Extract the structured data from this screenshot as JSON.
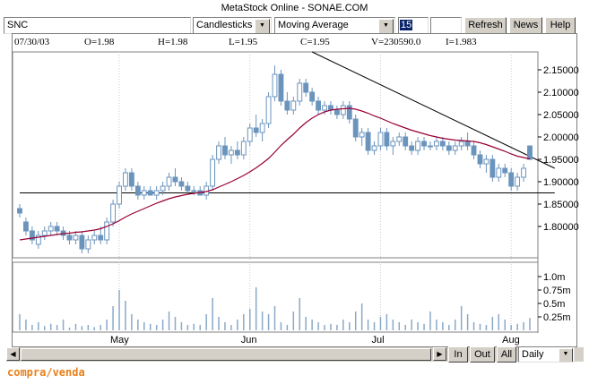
{
  "window": {
    "title": "MetaStock Online - SONAE.COM"
  },
  "toolbar": {
    "symbol_value": "SNC",
    "chart_type_value": "Candlesticks",
    "indicator_value": "Moving Average",
    "period_value": "15",
    "extra_value": "",
    "refresh_label": "Refresh",
    "news_label": "News",
    "help_label": "Help"
  },
  "quote": {
    "date": "07/30/03",
    "open": "O=1.98",
    "high": "H=1.98",
    "low": "L=1.95",
    "close": "C=1.95",
    "volume": "V=230590.0",
    "indicator": "I=1.983"
  },
  "price_axis": [
    "2.15000",
    "2.10000",
    "2.05000",
    "2.00000",
    "1.95000",
    "1.90000",
    "1.85000",
    "1.80000"
  ],
  "volume_axis": [
    "1.0m",
    "0.75m",
    "0.5m",
    "0.25m"
  ],
  "months": [
    "May",
    "Jun",
    "Jul",
    "Aug"
  ],
  "bottom_bar": {
    "in_label": "In",
    "out_label": "Out",
    "all_label": "All",
    "interval_value": "Daily"
  },
  "brand_text": "compra/venda",
  "colors": {
    "candle_up": "#ffffff",
    "candle_down": "#6b94bd",
    "candle_border": "#6b94bd",
    "moving_average": "#990033",
    "trend_lines": "#000000",
    "volume_bars": "#8aa8c8"
  },
  "chart_data": [
    {
      "type": "candlestick",
      "title": "",
      "ylim": [
        1.73,
        2.19
      ],
      "y_ticks": [
        2.15,
        2.1,
        2.05,
        2.0,
        1.95,
        1.9,
        1.85,
        1.8
      ],
      "x_ticks": [
        "May",
        "Jun",
        "Jul",
        "Aug"
      ],
      "ohlc": [
        [
          1.84,
          1.85,
          1.82,
          1.83
        ],
        [
          1.81,
          1.82,
          1.78,
          1.79
        ],
        [
          1.79,
          1.8,
          1.76,
          1.77
        ],
        [
          1.76,
          1.79,
          1.75,
          1.78
        ],
        [
          1.78,
          1.8,
          1.77,
          1.79
        ],
        [
          1.79,
          1.81,
          1.78,
          1.8
        ],
        [
          1.8,
          1.81,
          1.78,
          1.79
        ],
        [
          1.79,
          1.8,
          1.77,
          1.78
        ],
        [
          1.78,
          1.79,
          1.76,
          1.77
        ],
        [
          1.77,
          1.79,
          1.76,
          1.78
        ],
        [
          1.78,
          1.79,
          1.74,
          1.75
        ],
        [
          1.75,
          1.78,
          1.74,
          1.77
        ],
        [
          1.77,
          1.79,
          1.76,
          1.78
        ],
        [
          1.78,
          1.8,
          1.76,
          1.77
        ],
        [
          1.77,
          1.82,
          1.76,
          1.81
        ],
        [
          1.81,
          1.86,
          1.8,
          1.85
        ],
        [
          1.85,
          1.9,
          1.84,
          1.89
        ],
        [
          1.89,
          1.93,
          1.88,
          1.92
        ],
        [
          1.92,
          1.93,
          1.88,
          1.89
        ],
        [
          1.89,
          1.9,
          1.86,
          1.87
        ],
        [
          1.87,
          1.89,
          1.86,
          1.88
        ],
        [
          1.88,
          1.89,
          1.87,
          1.87
        ],
        [
          1.87,
          1.89,
          1.86,
          1.88
        ],
        [
          1.88,
          1.9,
          1.87,
          1.89
        ],
        [
          1.89,
          1.92,
          1.88,
          1.91
        ],
        [
          1.91,
          1.93,
          1.89,
          1.9
        ],
        [
          1.9,
          1.91,
          1.88,
          1.89
        ],
        [
          1.89,
          1.9,
          1.87,
          1.88
        ],
        [
          1.88,
          1.89,
          1.87,
          1.88
        ],
        [
          1.88,
          1.89,
          1.87,
          1.87
        ],
        [
          1.87,
          1.9,
          1.86,
          1.89
        ],
        [
          1.89,
          1.96,
          1.88,
          1.95
        ],
        [
          1.95,
          1.99,
          1.94,
          1.98
        ],
        [
          1.98,
          2.0,
          1.95,
          1.96
        ],
        [
          1.96,
          1.98,
          1.94,
          1.97
        ],
        [
          1.97,
          1.99,
          1.95,
          1.96
        ],
        [
          1.96,
          2.0,
          1.95,
          1.99
        ],
        [
          1.99,
          2.03,
          1.98,
          2.02
        ],
        [
          2.02,
          2.05,
          2.0,
          2.01
        ],
        [
          2.01,
          2.04,
          1.99,
          2.03
        ],
        [
          2.03,
          2.1,
          2.02,
          2.09
        ],
        [
          2.09,
          2.16,
          2.08,
          2.14
        ],
        [
          2.14,
          2.15,
          2.07,
          2.08
        ],
        [
          2.08,
          2.1,
          2.05,
          2.06
        ],
        [
          2.06,
          2.09,
          2.05,
          2.08
        ],
        [
          2.08,
          2.13,
          2.07,
          2.12
        ],
        [
          2.12,
          2.13,
          2.09,
          2.1
        ],
        [
          2.1,
          2.11,
          2.07,
          2.08
        ],
        [
          2.08,
          2.09,
          2.05,
          2.06
        ],
        [
          2.06,
          2.08,
          2.05,
          2.07
        ],
        [
          2.07,
          2.08,
          2.05,
          2.06
        ],
        [
          2.06,
          2.07,
          2.04,
          2.05
        ],
        [
          2.05,
          2.08,
          2.04,
          2.07
        ],
        [
          2.07,
          2.08,
          2.03,
          2.04
        ],
        [
          2.04,
          2.05,
          1.99,
          2.0
        ],
        [
          2.0,
          2.02,
          1.98,
          2.01
        ],
        [
          2.01,
          2.02,
          1.96,
          1.97
        ],
        [
          1.97,
          1.99,
          1.96,
          1.98
        ],
        [
          1.98,
          2.02,
          1.97,
          2.01
        ],
        [
          2.01,
          2.02,
          1.97,
          1.98
        ],
        [
          1.98,
          2.0,
          1.96,
          1.99
        ],
        [
          1.99,
          2.01,
          1.98,
          2.0
        ],
        [
          2.0,
          2.01,
          1.97,
          1.98
        ],
        [
          1.98,
          1.99,
          1.96,
          1.97
        ],
        [
          1.97,
          2.0,
          1.96,
          1.99
        ],
        [
          1.99,
          2.0,
          1.97,
          1.98
        ],
        [
          1.98,
          1.99,
          1.97,
          1.98
        ],
        [
          1.98,
          2.0,
          1.97,
          1.99
        ],
        [
          1.99,
          2.0,
          1.97,
          1.98
        ],
        [
          1.98,
          1.99,
          1.96,
          1.97
        ],
        [
          1.97,
          1.99,
          1.96,
          1.98
        ],
        [
          1.98,
          2.0,
          1.97,
          1.99
        ],
        [
          1.99,
          2.01,
          1.97,
          1.98
        ],
        [
          1.98,
          1.99,
          1.95,
          1.96
        ],
        [
          1.96,
          1.97,
          1.93,
          1.94
        ],
        [
          1.94,
          1.96,
          1.92,
          1.95
        ],
        [
          1.95,
          1.96,
          1.9,
          1.91
        ],
        [
          1.91,
          1.94,
          1.9,
          1.93
        ],
        [
          1.93,
          1.94,
          1.91,
          1.92
        ],
        [
          1.92,
          1.93,
          1.88,
          1.89
        ],
        [
          1.89,
          1.92,
          1.88,
          1.91
        ],
        [
          1.91,
          1.94,
          1.9,
          1.93
        ],
        [
          1.98,
          1.98,
          1.95,
          1.95
        ]
      ],
      "moving_average": [
        1.77,
        1.772,
        1.774,
        1.776,
        1.778,
        1.78,
        1.782,
        1.784,
        1.785,
        1.787,
        1.788,
        1.79,
        1.792,
        1.795,
        1.8,
        1.806,
        1.813,
        1.821,
        1.828,
        1.834,
        1.84,
        1.846,
        1.852,
        1.857,
        1.862,
        1.866,
        1.869,
        1.872,
        1.874,
        1.876,
        1.878,
        1.882,
        1.888,
        1.894,
        1.9,
        1.907,
        1.914,
        1.922,
        1.931,
        1.941,
        1.952,
        1.966,
        1.981,
        1.994,
        2.006,
        2.02,
        2.032,
        2.042,
        2.05,
        2.056,
        2.06,
        2.062,
        2.063,
        2.064,
        2.062,
        2.058,
        2.053,
        2.047,
        2.042,
        2.036,
        2.03,
        2.025,
        2.02,
        2.015,
        2.011,
        2.007,
        2.003,
        2.0,
        1.997,
        1.995,
        1.993,
        1.992,
        1.991,
        1.99,
        1.987,
        1.983,
        1.978,
        1.973,
        1.968,
        1.962,
        1.957,
        1.954,
        1.951
      ],
      "trend_lines": [
        {
          "from": [
            47,
            2.19
          ],
          "to": [
            86,
            1.93
          ]
        },
        {
          "from": [
            0,
            1.875
          ],
          "to": [
            86,
            1.875
          ]
        }
      ]
    },
    {
      "type": "bar",
      "title": "",
      "ylim": [
        0,
        1.2
      ],
      "y_ticks": [
        1.0,
        0.75,
        0.5,
        0.25
      ],
      "values": [
        0.3,
        0.2,
        0.1,
        0.15,
        0.08,
        0.12,
        0.1,
        0.2,
        0.05,
        0.12,
        0.08,
        0.1,
        0.06,
        0.1,
        0.2,
        0.45,
        0.75,
        0.55,
        0.3,
        0.2,
        0.15,
        0.12,
        0.1,
        0.2,
        0.35,
        0.25,
        0.15,
        0.1,
        0.12,
        0.1,
        0.3,
        0.6,
        0.25,
        0.15,
        0.1,
        0.2,
        0.3,
        0.4,
        0.8,
        0.35,
        0.3,
        0.45,
        0.15,
        0.1,
        0.35,
        0.6,
        0.25,
        0.2,
        0.15,
        0.1,
        0.12,
        0.1,
        0.2,
        0.15,
        0.35,
        0.5,
        0.2,
        0.15,
        0.25,
        0.3,
        0.2,
        0.15,
        0.1,
        0.2,
        0.15,
        0.12,
        0.35,
        0.2,
        0.15,
        0.1,
        0.2,
        0.45,
        0.3,
        0.15,
        0.12,
        0.1,
        0.25,
        0.3,
        0.2,
        0.1,
        0.12,
        0.15,
        0.23
      ]
    }
  ]
}
